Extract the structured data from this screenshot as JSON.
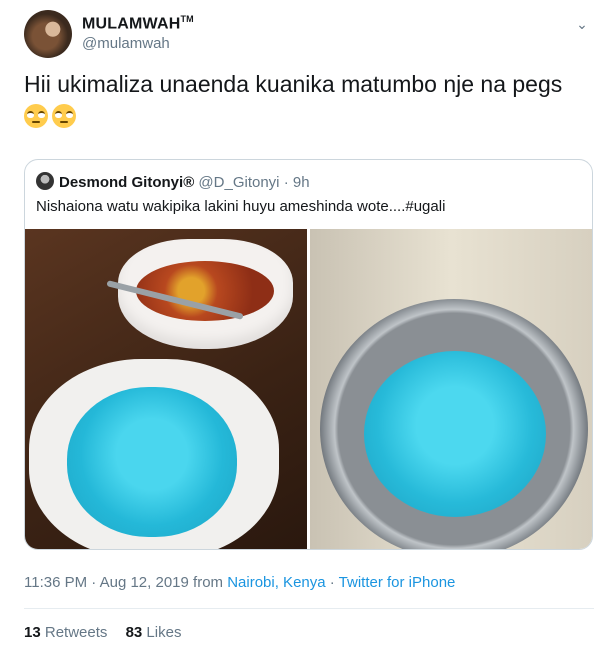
{
  "tweet": {
    "display_name": "MULAMWAH",
    "trademark": "TM",
    "handle": "@mulamwah",
    "text": "Hii ukimaliza unaenda kuanika matumbo nje na pegs",
    "emojis": [
      "face-with-rolling-eyes",
      "face-with-rolling-eyes"
    ]
  },
  "quoted": {
    "name": "Desmond Gitonyi",
    "badge": "®",
    "handle": "@D_Gitonyi",
    "time": "· 9h",
    "text": "Nishaiona watu wakipika lakini huyu ameshinda wote....#ugali",
    "photos": [
      "blue-rice-in-bowl",
      "blue-rice-in-pot"
    ]
  },
  "meta": {
    "time": "11:36 PM",
    "sep1": "·",
    "date": "Aug 12, 2019",
    "from": "from",
    "location": "Nairobi, Kenya",
    "sep2": "·",
    "source": "Twitter for iPhone"
  },
  "stats": {
    "retweets_count": "13",
    "retweets_label": "Retweets",
    "likes_count": "83",
    "likes_label": "Likes"
  },
  "colors": {
    "link": "#1b95e0",
    "muted": "#657786",
    "border": "#ccd6dd"
  }
}
